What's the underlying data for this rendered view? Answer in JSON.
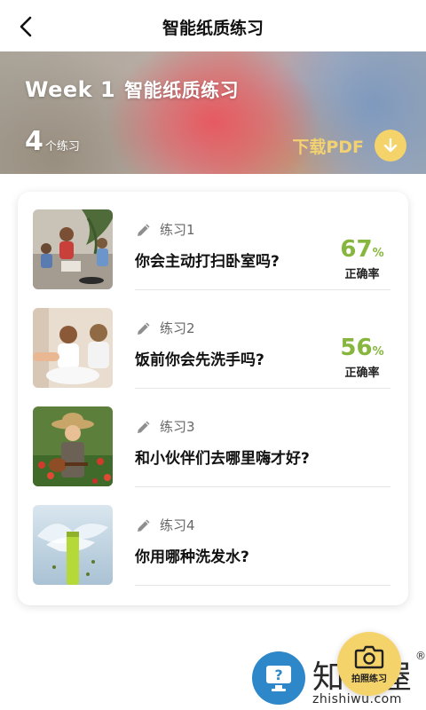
{
  "nav": {
    "title": "智能纸质练习",
    "back_icon": "chevron-left-icon"
  },
  "banner": {
    "week": "Week 1",
    "title": "智能纸质练习",
    "count_number": "4",
    "count_unit": "个练习",
    "download_label": "下载PDF",
    "download_icon": "arrow-down-icon",
    "accent": "#f5d36b"
  },
  "exercises": [
    {
      "label": "练习1",
      "question": "你会主动打扫卧室吗?",
      "accuracy": "67",
      "accuracy_unit": "%",
      "accuracy_label": "正确率",
      "image": "children-cleaning-photo"
    },
    {
      "label": "练习2",
      "question": "饭前你会先洗手吗?",
      "accuracy": "56",
      "accuracy_unit": "%",
      "accuracy_label": "正确率",
      "image": "children-washing-hands-photo"
    },
    {
      "label": "练习3",
      "question": "和小伙伴们去哪里嗨才好?",
      "image": "boy-with-ukulele-photo"
    },
    {
      "label": "练习4",
      "question": "你用哪种洗发水?",
      "image": "water-splash-bottle-photo"
    }
  ],
  "score_color": "#86b63d",
  "fab": {
    "label": "拍照练习",
    "icon": "camera-icon"
  },
  "watermark": {
    "title": "知识屋",
    "url": "zhishiwu.com",
    "reg": "®",
    "icon": "question-monitor-icon"
  }
}
